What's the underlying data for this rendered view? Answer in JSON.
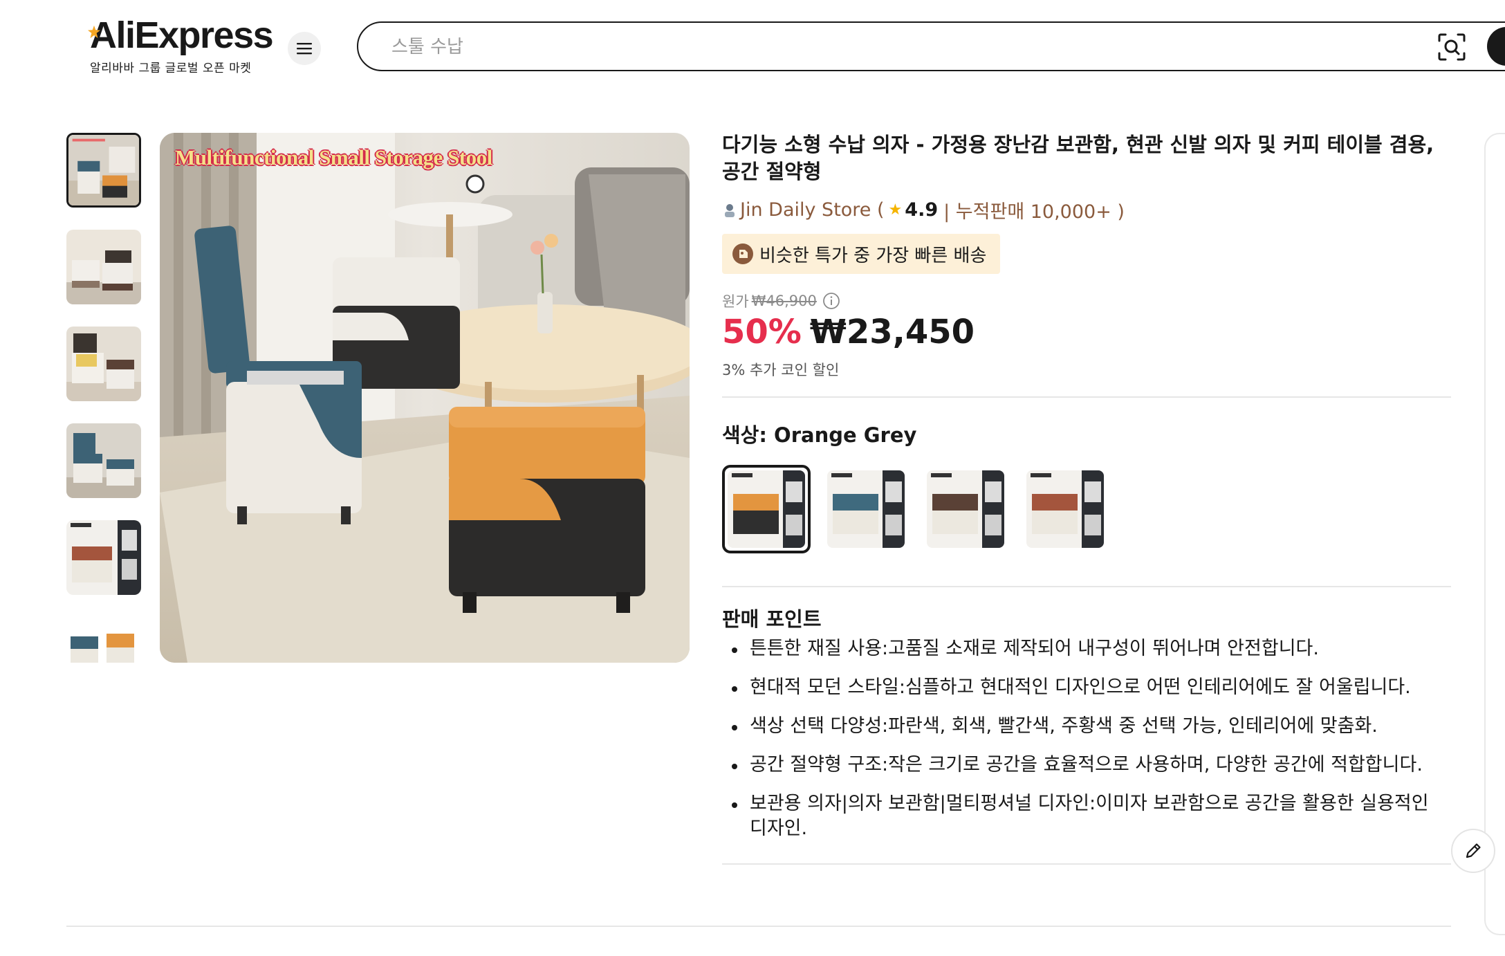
{
  "header": {
    "logo_text": "AliExpress",
    "logo_subtitle": "알리바바 그룹 글로벌 오픈 마켓",
    "menu_icon": "hamburger-menu-icon",
    "search": {
      "value": "",
      "placeholder": "스툴 수납"
    },
    "camera_icon": "image-search-icon"
  },
  "gallery": {
    "main_caption": "Multifunctional Small Storage Stool",
    "thumbnail_count": 6,
    "active_thumbnail": 0
  },
  "product": {
    "title": "다기능 소형 수납 의자 - 가정용 장난감 보관함, 현관 신발 의자 및 커피 테이블 겸용, 공간 절약형",
    "store": {
      "name": "Jin Daily Store (",
      "rating": "4.9",
      "sold": "| 누적판매 10,000+ )"
    },
    "badge": "비슷한 특가 중 가장 빠른 배송",
    "original_label": "원가",
    "original_price": "₩46,900",
    "discount": "50%",
    "price": "₩23,450",
    "coin_discount": "3% 추가 코인 할인",
    "color_label": "색상: Orange Grey",
    "colors": [
      {
        "name": "Orange Grey",
        "top": "#e3953f",
        "body": "#2f2f2f"
      },
      {
        "name": "Blue White",
        "top": "#3f6a7e",
        "body": "#ece8df"
      },
      {
        "name": "Brown White",
        "top": "#5a4136",
        "body": "#ece8df"
      },
      {
        "name": "Red White",
        "top": "#a4553d",
        "body": "#ece8df"
      }
    ],
    "selected_color": 0,
    "selling_points_title": "판매 포인트",
    "selling_points": [
      "튼튼한 재질 사용:고품질 소재로 제작되어 내구성이 뛰어나며 안전합니다.",
      "현대적 모던 스타일:심플하고 현대적인 디자인으로 어떤 인테리어에도 잘 어울립니다.",
      "색상 선택 다양성:파란색, 회색, 빨간색, 주황색 중 선택 가능, 인테리어에 맞춤화.",
      "공간 절약형 구조:작은 크기로 공간을 효율적으로 사용하며, 다양한 공간에 적합합니다.",
      "보관용 의자|의자 보관함|멀티펑셔널 디자인:이미자 보관함으로 공간을 활용한 실용적인 디자인."
    ]
  },
  "colors": {
    "accent": "#e62e4d",
    "text": "#191919",
    "store": "#8a5a3c",
    "badge_bg": "#fdf0d8",
    "star": "#f5b400"
  }
}
